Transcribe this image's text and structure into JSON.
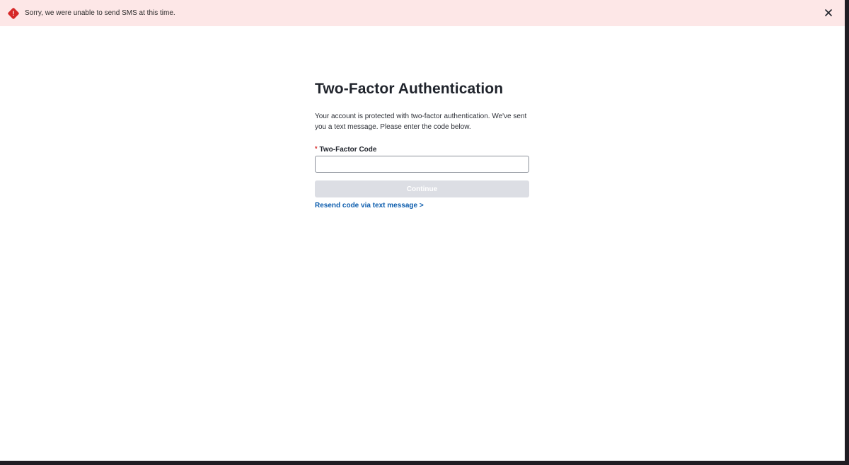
{
  "alert": {
    "message": "Sorry, we were unable to send SMS at this time.",
    "icon": "error-diamond-icon",
    "icon_glyph": "!",
    "close_icon": "close-icon",
    "color": "#d62828",
    "background": "#fde7e7"
  },
  "auth": {
    "title": "Two-Factor Authentication",
    "description": "Your account is protected with two-factor authentication. We've sent you a text message. Please enter the code below.",
    "field": {
      "required_marker": "*",
      "label": "Two-Factor Code",
      "value": "",
      "placeholder": ""
    },
    "continue_label": "Continue",
    "resend_label": "Resend code via text message >"
  },
  "colors": {
    "link": "#0b5cad",
    "button_disabled": "#dcdee4"
  }
}
